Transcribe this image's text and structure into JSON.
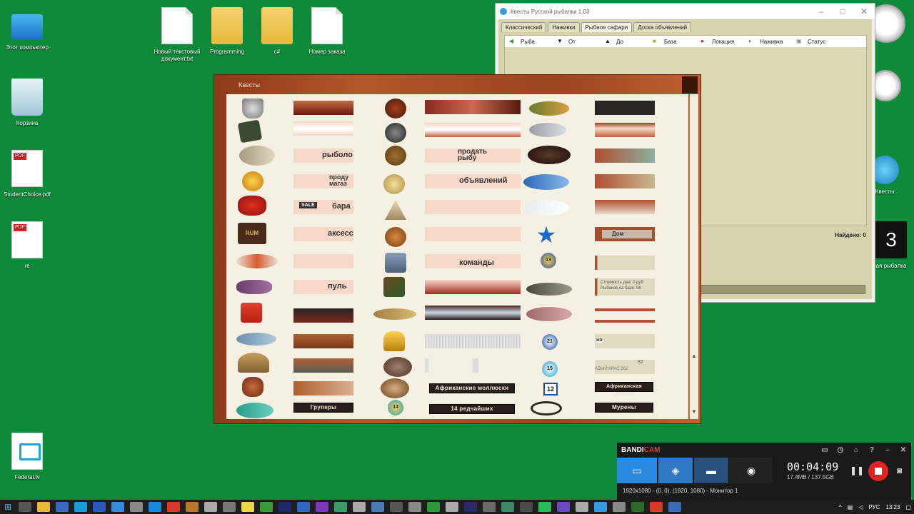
{
  "desktop": {
    "icons": [
      {
        "label": "Этот компьютер"
      },
      {
        "label": "Корзина"
      },
      {
        "label": "StudentChoice.pdf"
      },
      {
        "label": "re"
      },
      {
        "label": "Federal.tv"
      },
      {
        "label": "Новый текстовый документ.txt"
      },
      {
        "label": "Programming"
      },
      {
        "label": "c#"
      },
      {
        "label": "Номер заказа"
      },
      {
        "label": "Квесты"
      },
      {
        "label": "ая рыбалка"
      }
    ]
  },
  "bg_window": {
    "title": "Квесты Русской рыбалки 1.03",
    "tabs": [
      "Классический",
      "Наживки",
      "Рыбное сафари",
      "Доска объявлений"
    ],
    "columns": [
      "Рыба",
      "От",
      "До",
      "База",
      "Локация",
      "Наживка",
      "Статус"
    ],
    "found": "Найдено: 0"
  },
  "quests_window": {
    "title": "Квесты",
    "col2_cards": [
      "рыболо",
      "проду магаз",
      "бара",
      "аксесс",
      "пуль"
    ],
    "col4_cards": [
      "продать рыбу",
      "объявлений",
      "команды"
    ],
    "col6_cards": [
      "Дом",
      "Стоимость дня: 0 руб Рыбаков на базе: 96",
      "82",
      "АВЫЙ КРАС 262",
      "ия"
    ],
    "buttons": {
      "groupers": "Груперы",
      "african_molluscs": "Африканские моллюски",
      "rare_14": "14 редчайших",
      "african_dozen": "Африканская дюжина",
      "morays": "Мурены"
    },
    "badges": [
      "13",
      "21",
      "15",
      "12",
      "14"
    ],
    "sale_tag": "SALE",
    "rum_label": "RUM"
  },
  "bandicam": {
    "brand_a": "BANDI",
    "brand_b": "CAM",
    "time": "00:04:09",
    "size": "17.4MB / 137.5GB",
    "footer": "1920x1080 - (0, 0), (1920, 1080) - Монитор 1"
  },
  "taskbar": {
    "lang": "РУС",
    "clock": "13:23"
  },
  "colors": {
    "desktop": "#0f8a3a",
    "wood": "#b5552a",
    "panel": "#f5f0e1",
    "bandicam_accent": "#2a88e0",
    "record": "#e02424"
  }
}
